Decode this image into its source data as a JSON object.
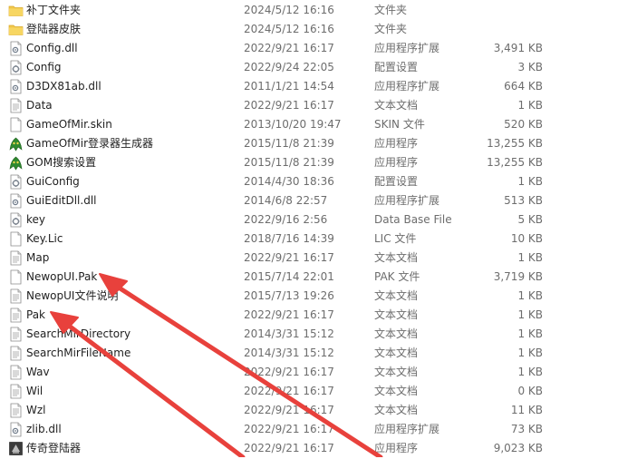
{
  "files": [
    {
      "name": "补丁文件夹",
      "modified": "2024/5/12 16:16",
      "type": "文件夹",
      "size": "",
      "icon": "folder-icon"
    },
    {
      "name": "登陆器皮肤",
      "modified": "2024/5/12 16:16",
      "type": "文件夹",
      "size": "",
      "icon": "folder-icon"
    },
    {
      "name": "Config.dll",
      "modified": "2022/9/21 16:17",
      "type": "应用程序扩展",
      "size": "3,491 KB",
      "icon": "dll-icon"
    },
    {
      "name": "Config",
      "modified": "2022/9/24 22:05",
      "type": "配置设置",
      "size": "3 KB",
      "icon": "config-icon"
    },
    {
      "name": "D3DX81ab.dll",
      "modified": "2011/1/21 14:54",
      "type": "应用程序扩展",
      "size": "664 KB",
      "icon": "dll-icon"
    },
    {
      "name": "Data",
      "modified": "2022/9/21 16:17",
      "type": "文本文档",
      "size": "1 KB",
      "icon": "text-file-icon"
    },
    {
      "name": "GameOfMir.skin",
      "modified": "2013/10/20 19:47",
      "type": "SKIN 文件",
      "size": "520 KB",
      "icon": "blank-file-icon"
    },
    {
      "name": "GameOfMir登录器生成器",
      "modified": "2015/11/8 21:39",
      "type": "应用程序",
      "size": "13,255 KB",
      "icon": "app-icon"
    },
    {
      "name": "GOM搜索设置",
      "modified": "2015/11/8 21:39",
      "type": "应用程序",
      "size": "13,255 KB",
      "icon": "app-icon"
    },
    {
      "name": "GuiConfig",
      "modified": "2014/4/30 18:36",
      "type": "配置设置",
      "size": "1 KB",
      "icon": "config-icon"
    },
    {
      "name": "GuiEditDll.dll",
      "modified": "2014/6/8 22:57",
      "type": "应用程序扩展",
      "size": "513 KB",
      "icon": "dll-icon"
    },
    {
      "name": "key",
      "modified": "2022/9/16 2:56",
      "type": "Data Base File",
      "size": "5 KB",
      "icon": "config-icon"
    },
    {
      "name": "Key.Lic",
      "modified": "2018/7/16 14:39",
      "type": "LIC 文件",
      "size": "10 KB",
      "icon": "blank-file-icon"
    },
    {
      "name": "Map",
      "modified": "2022/9/21 16:17",
      "type": "文本文档",
      "size": "1 KB",
      "icon": "text-file-icon"
    },
    {
      "name": "NewopUI.Pak",
      "modified": "2015/7/14 22:01",
      "type": "PAK 文件",
      "size": "3,719 KB",
      "icon": "blank-file-icon"
    },
    {
      "name": "NewopUI文件说明",
      "modified": "2015/7/13 19:26",
      "type": "文本文档",
      "size": "1 KB",
      "icon": "text-file-icon"
    },
    {
      "name": "Pak",
      "modified": "2022/9/21 16:17",
      "type": "文本文档",
      "size": "1 KB",
      "icon": "text-file-icon"
    },
    {
      "name": "SearchMirDirectory",
      "modified": "2014/3/31 15:12",
      "type": "文本文档",
      "size": "1 KB",
      "icon": "text-file-icon"
    },
    {
      "name": "SearchMirFileName",
      "modified": "2014/3/31 15:12",
      "type": "文本文档",
      "size": "1 KB",
      "icon": "text-file-icon"
    },
    {
      "name": "Wav",
      "modified": "2022/9/21 16:17",
      "type": "文本文档",
      "size": "1 KB",
      "icon": "text-file-icon"
    },
    {
      "name": "Wil",
      "modified": "2022/9/21 16:17",
      "type": "文本文档",
      "size": "0 KB",
      "icon": "text-file-icon"
    },
    {
      "name": "Wzl",
      "modified": "2022/9/21 16:17",
      "type": "文本文档",
      "size": "11 KB",
      "icon": "text-file-icon"
    },
    {
      "name": "zlib.dll",
      "modified": "2022/9/21 16:17",
      "type": "应用程序扩展",
      "size": "73 KB",
      "icon": "dll-icon"
    },
    {
      "name": "传奇登陆器",
      "modified": "2022/9/21 16:17",
      "type": "应用程序",
      "size": "9,023 KB",
      "icon": "launcher-app-icon"
    }
  ],
  "colors": {
    "annotation_arrow": "#e8413c",
    "folder": "#f2c84b",
    "text_primary": "#1f1f1f",
    "text_secondary": "#6d6d6d"
  }
}
